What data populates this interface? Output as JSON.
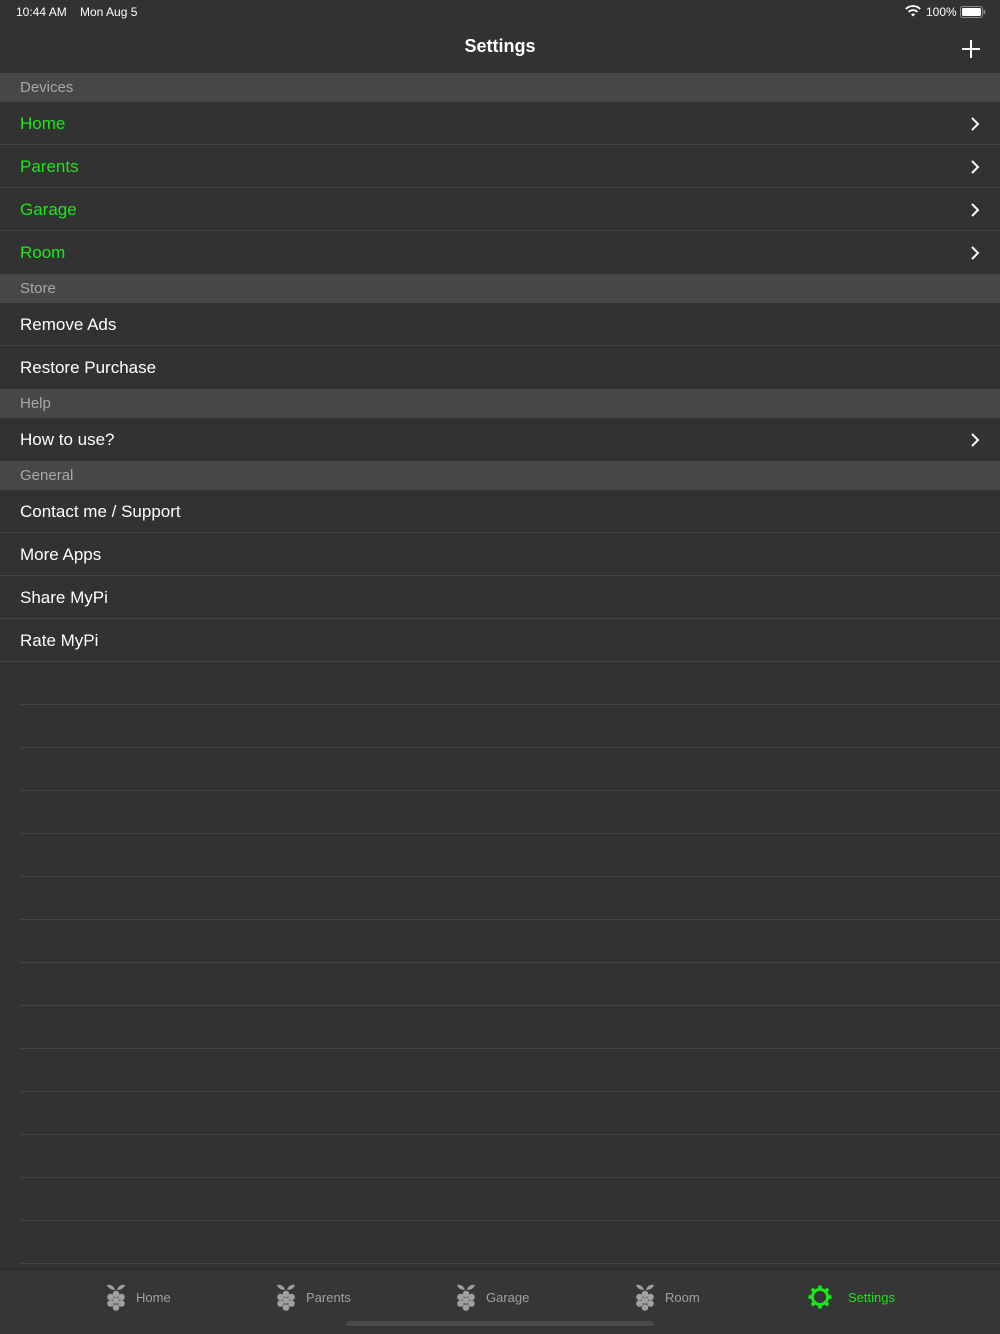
{
  "status_bar": {
    "time": "10:44 AM",
    "date": "Mon Aug 5",
    "battery": "100%",
    "icons": [
      "wifi-icon",
      "battery-icon"
    ]
  },
  "nav": {
    "title": "Settings",
    "add_icon": "plus-icon"
  },
  "sections": {
    "devices": {
      "header": "Devices",
      "items": [
        {
          "label": "Home"
        },
        {
          "label": "Parents"
        },
        {
          "label": "Garage"
        },
        {
          "label": "Room"
        }
      ]
    },
    "store": {
      "header": "Store",
      "items": [
        {
          "label": "Remove Ads"
        },
        {
          "label": "Restore Purchase"
        }
      ]
    },
    "help": {
      "header": "Help",
      "items": [
        {
          "label": "How to use?"
        }
      ]
    },
    "general": {
      "header": "General",
      "items": [
        {
          "label": "Contact me / Support"
        },
        {
          "label": "More Apps"
        },
        {
          "label": "Share MyPi"
        },
        {
          "label": "Rate MyPi"
        }
      ]
    }
  },
  "tab_bar": {
    "tabs": [
      {
        "label": "Home",
        "icon": "raspberry-icon"
      },
      {
        "label": "Parents",
        "icon": "raspberry-icon"
      },
      {
        "label": "Garage",
        "icon": "raspberry-icon"
      },
      {
        "label": "Room",
        "icon": "raspberry-icon"
      },
      {
        "label": "Settings",
        "icon": "gear-icon",
        "active": true
      }
    ]
  },
  "colors": {
    "accent": "#18e818",
    "background": "#323232",
    "section_header": "#474747",
    "tab_inactive": "#a0a0a0"
  }
}
